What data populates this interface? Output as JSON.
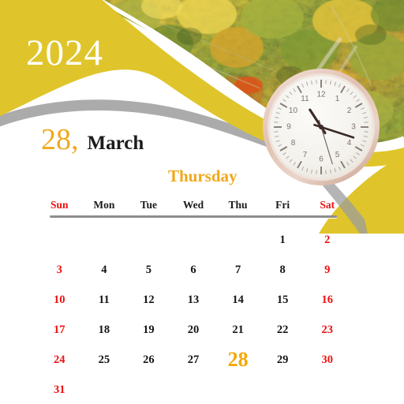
{
  "header": {
    "year": "2024",
    "day_number": "28",
    "day_number_suffix": ",",
    "month": "March",
    "weekday": "Thursday"
  },
  "theme": {
    "yellow": "#DFC52B",
    "accent_orange": "#F0A81E",
    "weekend_red": "#EE1111",
    "text_dark": "#151515",
    "rule_gray": "#8d8d8d",
    "background": "#FFFFFF"
  },
  "photo": {
    "description": "aerial-autumn-forest-canopy",
    "palette": [
      "#E8C63A",
      "#C9A42A",
      "#8FA33C",
      "#4F6B2A",
      "#D97A24",
      "#F2D34E",
      "#6E8A33",
      "#B5541C"
    ]
  },
  "clock": {
    "hour_numerals": [
      "12",
      "1",
      "2",
      "3",
      "4",
      "5",
      "6",
      "7",
      "8",
      "9",
      "10",
      "11"
    ],
    "hour_hand_deg": 327,
    "minute_hand_deg": 108,
    "second_hand_deg": 163,
    "face_color": "#F4F2EE",
    "rim_color": "#E3C9BF",
    "hand_color": "#3B2A26"
  },
  "calendar": {
    "weekday_headers": [
      {
        "label": "Sun",
        "weekend": true
      },
      {
        "label": "Mon",
        "weekend": false
      },
      {
        "label": "Tue",
        "weekend": false
      },
      {
        "label": "Wed",
        "weekend": false
      },
      {
        "label": "Thu",
        "weekend": false
      },
      {
        "label": "Fri",
        "weekend": false
      },
      {
        "label": "Sat",
        "weekend": true
      }
    ],
    "weeks": [
      [
        {
          "label": "",
          "empty": true,
          "weekend": true,
          "today": false
        },
        {
          "label": "",
          "empty": true,
          "weekend": false,
          "today": false
        },
        {
          "label": "",
          "empty": true,
          "weekend": false,
          "today": false
        },
        {
          "label": "",
          "empty": true,
          "weekend": false,
          "today": false
        },
        {
          "label": "",
          "empty": true,
          "weekend": false,
          "today": false
        },
        {
          "label": "1",
          "empty": false,
          "weekend": false,
          "today": false
        },
        {
          "label": "2",
          "empty": false,
          "weekend": true,
          "today": false
        }
      ],
      [
        {
          "label": "3",
          "empty": false,
          "weekend": true,
          "today": false
        },
        {
          "label": "4",
          "empty": false,
          "weekend": false,
          "today": false
        },
        {
          "label": "5",
          "empty": false,
          "weekend": false,
          "today": false
        },
        {
          "label": "6",
          "empty": false,
          "weekend": false,
          "today": false
        },
        {
          "label": "7",
          "empty": false,
          "weekend": false,
          "today": false
        },
        {
          "label": "8",
          "empty": false,
          "weekend": false,
          "today": false
        },
        {
          "label": "9",
          "empty": false,
          "weekend": true,
          "today": false
        }
      ],
      [
        {
          "label": "10",
          "empty": false,
          "weekend": true,
          "today": false
        },
        {
          "label": "11",
          "empty": false,
          "weekend": false,
          "today": false
        },
        {
          "label": "12",
          "empty": false,
          "weekend": false,
          "today": false
        },
        {
          "label": "13",
          "empty": false,
          "weekend": false,
          "today": false
        },
        {
          "label": "14",
          "empty": false,
          "weekend": false,
          "today": false
        },
        {
          "label": "15",
          "empty": false,
          "weekend": false,
          "today": false
        },
        {
          "label": "16",
          "empty": false,
          "weekend": true,
          "today": false
        }
      ],
      [
        {
          "label": "17",
          "empty": false,
          "weekend": true,
          "today": false
        },
        {
          "label": "18",
          "empty": false,
          "weekend": false,
          "today": false
        },
        {
          "label": "19",
          "empty": false,
          "weekend": false,
          "today": false
        },
        {
          "label": "20",
          "empty": false,
          "weekend": false,
          "today": false
        },
        {
          "label": "21",
          "empty": false,
          "weekend": false,
          "today": false
        },
        {
          "label": "22",
          "empty": false,
          "weekend": false,
          "today": false
        },
        {
          "label": "23",
          "empty": false,
          "weekend": true,
          "today": false
        }
      ],
      [
        {
          "label": "24",
          "empty": false,
          "weekend": true,
          "today": false
        },
        {
          "label": "25",
          "empty": false,
          "weekend": false,
          "today": false
        },
        {
          "label": "26",
          "empty": false,
          "weekend": false,
          "today": false
        },
        {
          "label": "27",
          "empty": false,
          "weekend": false,
          "today": false
        },
        {
          "label": "28",
          "empty": false,
          "weekend": false,
          "today": true
        },
        {
          "label": "29",
          "empty": false,
          "weekend": false,
          "today": false
        },
        {
          "label": "30",
          "empty": false,
          "weekend": true,
          "today": false
        }
      ],
      [
        {
          "label": "31",
          "empty": false,
          "weekend": true,
          "today": false
        },
        {
          "label": "",
          "empty": true,
          "weekend": false,
          "today": false
        },
        {
          "label": "",
          "empty": true,
          "weekend": false,
          "today": false
        },
        {
          "label": "",
          "empty": true,
          "weekend": false,
          "today": false
        },
        {
          "label": "",
          "empty": true,
          "weekend": false,
          "today": false
        },
        {
          "label": "",
          "empty": true,
          "weekend": false,
          "today": false
        },
        {
          "label": "",
          "empty": true,
          "weekend": true,
          "today": false
        }
      ]
    ]
  }
}
